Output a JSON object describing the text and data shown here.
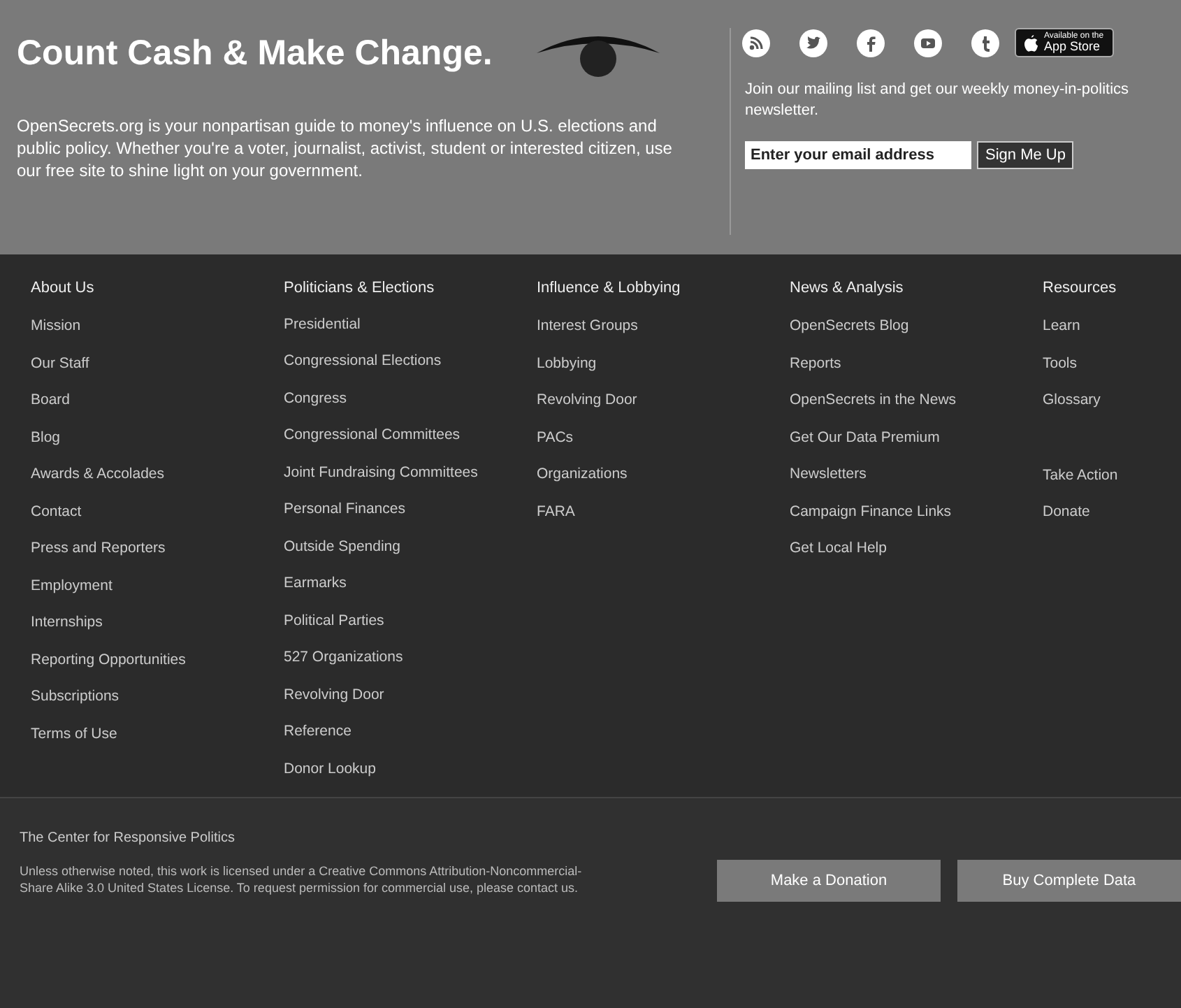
{
  "header": {
    "tagline": "Count Cash & Make Change.",
    "intro": "OpenSecrets.org is your nonpartisan guide to money's influence on U.S. elections and public policy. Whether you're a voter, journalist, activist, student or interested citizen, use our free site to shine light on your government.",
    "app_badge": {
      "small": "Available on the",
      "big": "App Store"
    },
    "newsletter": "Join our mailing list and get our weekly money-in-politics newsletter.",
    "email_field": {
      "placeholder": "Enter your email address"
    },
    "signup_button": "Sign Me Up"
  },
  "social": [
    {
      "kind": "rss"
    },
    {
      "kind": "twitter"
    },
    {
      "kind": "facebook"
    },
    {
      "kind": "youtube"
    },
    {
      "kind": "tumblr"
    }
  ],
  "columns": [
    {
      "heading": "About Us",
      "groups": [
        [
          "Mission",
          "Our Staff",
          "Board",
          "Blog",
          "Awards & Accolades",
          "Contact",
          "Press and Reporters",
          "Employment",
          "Internships",
          "Reporting Opportunities",
          "Subscriptions",
          "Terms of Use"
        ]
      ]
    },
    {
      "heading": "Politicians & Elections",
      "groups": [
        [
          "Presidential",
          "Congressional Elections",
          "Congress",
          "Congressional Committees",
          "Joint Fundraising Committees",
          "Personal Finances",
          "Outside Spending",
          "Earmarks",
          "Political Parties",
          "527 Organizations",
          "Revolving Door",
          "Reference",
          "Donor Lookup"
        ]
      ]
    },
    {
      "heading": "Influence & Lobbying",
      "groups": [
        [
          "Interest Groups",
          "Lobbying",
          "Revolving Door",
          "PACs",
          "Organizations",
          "FARA"
        ]
      ]
    },
    {
      "heading": "News & Analysis",
      "groups": [
        [
          "OpenSecrets Blog",
          "Reports",
          "OpenSecrets in the News",
          "Get Our Data Premium",
          "Newsletters",
          "Campaign Finance Links",
          "Get Local Help"
        ]
      ]
    },
    {
      "heading": "Resources",
      "groups": [
        [
          "Learn",
          "Tools",
          "Glossary"
        ],
        [
          "Take Action",
          "Donate"
        ]
      ]
    }
  ],
  "footer": {
    "org": "The Center for Responsive Politics",
    "license": "Unless otherwise noted, this work is licensed under a Creative Commons Attribution-Noncommercial-Share Alike 3.0 United States License. To request permission for commercial use, please contact us.",
    "buttons": [
      "Make a Donation",
      "Buy Complete Data"
    ]
  }
}
